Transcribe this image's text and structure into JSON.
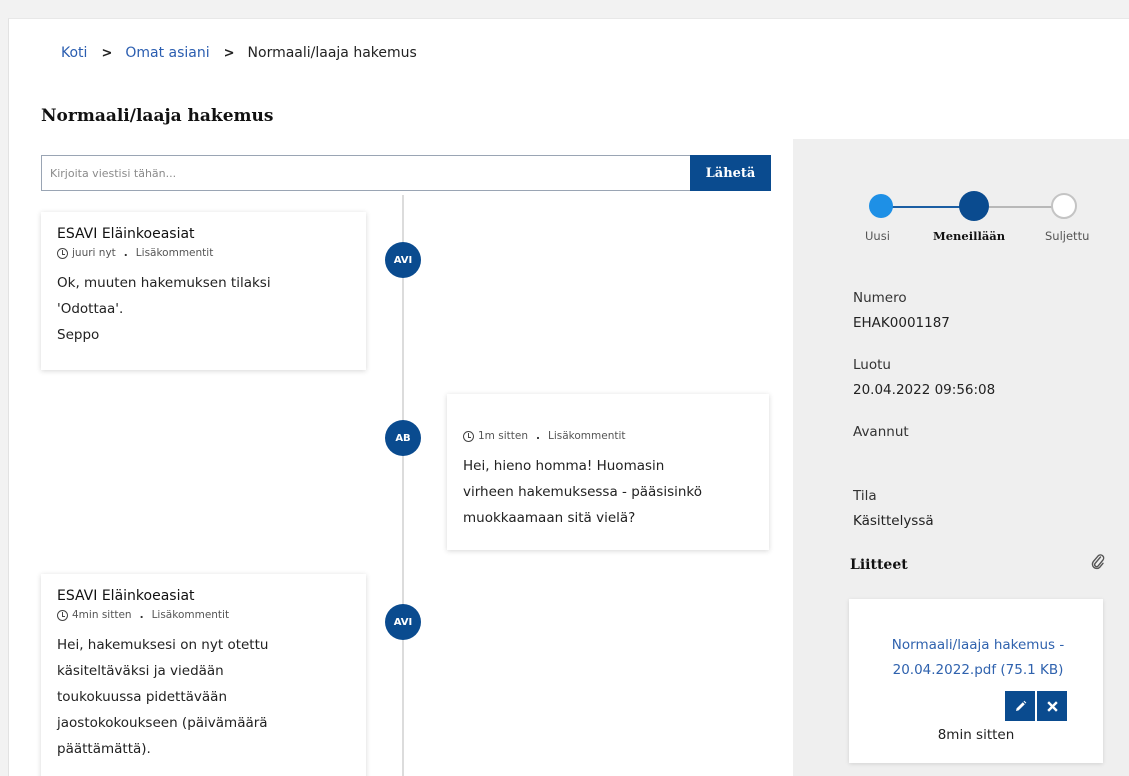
{
  "breadcrumb": {
    "items": [
      "Koti",
      "Omat asiani"
    ],
    "current": "Normaali/laaja hakemus",
    "separator": ">"
  },
  "page": {
    "title": "Normaali/laaja hakemus"
  },
  "message_form": {
    "placeholder": "Kirjoita viestisi tähän...",
    "send_label": "Lähetä"
  },
  "messages": [
    {
      "author": "ESAVI Eläinkoeasiat",
      "time": "juuri nyt",
      "more": "Lisäkommentit",
      "avatar": "AVI",
      "lines": [
        "Ok, muuten hakemuksen tilaksi",
        "'Odottaa'.",
        "Seppo"
      ]
    },
    {
      "time": "1m sitten",
      "more": "Lisäkommentit",
      "avatar": "AB",
      "lines": [
        "Hei, hieno homma! Huomasin",
        "virheen hakemuksessa - pääsisinkö",
        "muokkaamaan sitä vielä?"
      ]
    },
    {
      "author": "ESAVI Eläinkoeasiat",
      "time": "4min sitten",
      "more": "Lisäkommentit",
      "avatar": "AVI",
      "lines": [
        "Hei, hakemuksesi on nyt otettu",
        "käsiteltäväksi ja viedään",
        "toukokuussa pidettävään",
        "jaostokokoukseen (päivämäärä",
        "päättämättä)."
      ]
    }
  ],
  "status_steps": [
    "Uusi",
    "Meneillään",
    "Suljettu"
  ],
  "details": {
    "number_label": "Numero",
    "number_value": "EHAK0001187",
    "created_label": "Luotu",
    "created_value": "20.04.2022 09:56:08",
    "opened_label": "Avannut",
    "state_label": "Tila",
    "state_value": "Käsittelyssä"
  },
  "attachments": {
    "title": "Liitteet",
    "file_line1": "Normaali/laaja hakemus -",
    "file_line2": "20.04.2022.pdf (75.1 KB)",
    "time": "8min sitten"
  },
  "colors": {
    "primary": "#0a4b8f",
    "link": "#2a5db0",
    "step_new": "#1e90e6",
    "sidebar_bg": "#efefef"
  },
  "icons": [
    "clock-icon",
    "paperclip-icon",
    "pencil-icon",
    "close-icon",
    "chevron-right-icon"
  ]
}
